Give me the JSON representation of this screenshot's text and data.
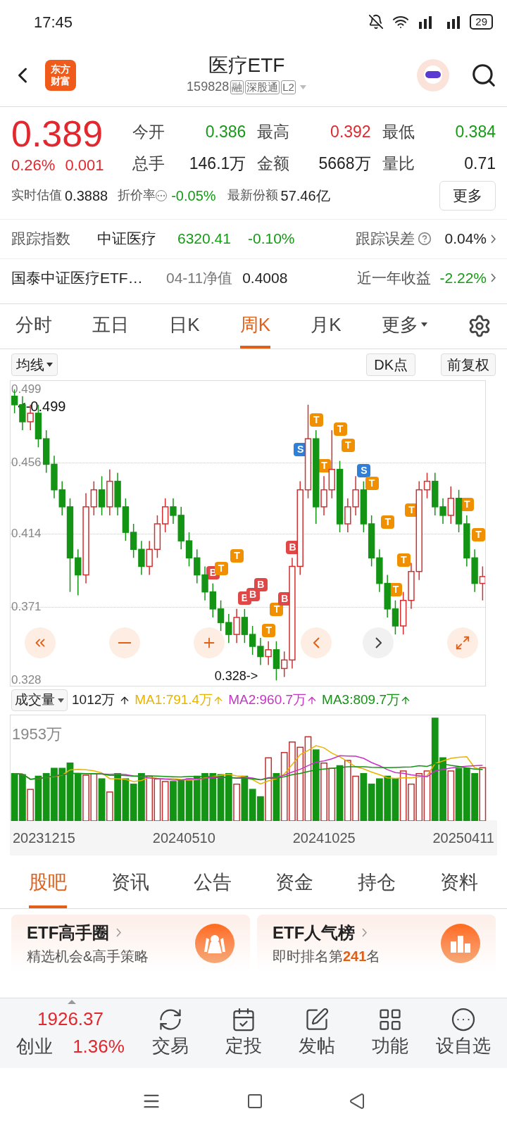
{
  "status_bar": {
    "time": "17:45",
    "battery": "29"
  },
  "header": {
    "logo_lines": [
      "东方",
      "财富"
    ],
    "title": "医疗ETF",
    "code": "159828",
    "tags": [
      "融",
      "深股通",
      "L2"
    ]
  },
  "quote": {
    "price": "0.389",
    "change_pct": "0.26%",
    "change": "0.001",
    "stats": [
      {
        "label": "今开",
        "value": "0.386",
        "color": "#169a16"
      },
      {
        "label": "最高",
        "value": "0.392",
        "color": "#e0282e"
      },
      {
        "label": "最低",
        "value": "0.384",
        "color": "#169a16"
      },
      {
        "label": "总手",
        "value": "146.1万",
        "color": "#222222"
      },
      {
        "label": "金额",
        "value": "5668万",
        "color": "#222222"
      },
      {
        "label": "量比",
        "value": "0.71",
        "color": "#222222"
      }
    ],
    "estimate_label": "实时估值",
    "estimate": "0.3888",
    "discount_label": "折价率",
    "discount": "-0.05%",
    "shares_label": "最新份额",
    "shares": "57.46亿",
    "more": "更多"
  },
  "tracking": {
    "label": "跟踪指数",
    "index": "中证医疗",
    "value": "6320.41",
    "pct": "-0.10%",
    "error_label": "跟踪误差",
    "error": "0.04%"
  },
  "fund": {
    "name": "国泰中证医疗ETF…",
    "nav_label": "04-11净值",
    "nav": "0.4008",
    "return_label": "近一年收益",
    "return": "-2.22%"
  },
  "period_tabs": [
    {
      "label": "分时",
      "selected": false
    },
    {
      "label": "五日",
      "selected": false
    },
    {
      "label": "日K",
      "selected": false
    },
    {
      "label": "周K",
      "selected": true
    },
    {
      "label": "月K",
      "selected": false
    },
    {
      "label": "更多",
      "selected": false
    }
  ],
  "chart_toolbar": {
    "ma": "均线",
    "dk": "DK点",
    "adjust": "前复权"
  },
  "kline": {
    "high_label": "<-0.499",
    "low_label": "0.328->",
    "chart_data": {
      "type": "candlestick",
      "grid": true,
      "ylim": [
        0.324,
        0.504
      ],
      "yticks": [
        0.499,
        0.456,
        0.414,
        0.371,
        0.328
      ],
      "categories": [
        null,
        null,
        null,
        null,
        null,
        null,
        null,
        null,
        null,
        null,
        null,
        null,
        null,
        null,
        null,
        null,
        null,
        null,
        null,
        null,
        null,
        null,
        null,
        null,
        null,
        null,
        null,
        null,
        null,
        null,
        null,
        null,
        null,
        null,
        null,
        null,
        null,
        null,
        null,
        null,
        null,
        null,
        null,
        null,
        null,
        null,
        null,
        null,
        null,
        null,
        null,
        null,
        null,
        null,
        null,
        null,
        null,
        null,
        null,
        null
      ],
      "ohlc": [
        [
          0.495,
          0.499,
          0.485,
          0.49
        ],
        [
          0.49,
          0.495,
          0.475,
          0.48
        ],
        [
          0.48,
          0.49,
          0.475,
          0.485
        ],
        [
          0.485,
          0.49,
          0.465,
          0.47
        ],
        [
          0.47,
          0.475,
          0.45,
          0.455
        ],
        [
          0.455,
          0.46,
          0.435,
          0.44
        ],
        [
          0.44,
          0.445,
          0.425,
          0.43
        ],
        [
          0.43,
          0.435,
          0.38,
          0.4
        ],
        [
          0.4,
          0.405,
          0.378,
          0.39
        ],
        [
          0.39,
          0.438,
          0.385,
          0.43
        ],
        [
          0.43,
          0.445,
          0.425,
          0.44
        ],
        [
          0.44,
          0.448,
          0.425,
          0.43
        ],
        [
          0.43,
          0.452,
          0.425,
          0.445
        ],
        [
          0.445,
          0.45,
          0.425,
          0.43
        ],
        [
          0.43,
          0.435,
          0.41,
          0.415
        ],
        [
          0.415,
          0.42,
          0.4,
          0.405
        ],
        [
          0.405,
          0.41,
          0.39,
          0.395
        ],
        [
          0.395,
          0.41,
          0.39,
          0.405
        ],
        [
          0.405,
          0.425,
          0.4,
          0.42
        ],
        [
          0.42,
          0.435,
          0.415,
          0.43
        ],
        [
          0.43,
          0.435,
          0.42,
          0.425
        ],
        [
          0.425,
          0.43,
          0.405,
          0.41
        ],
        [
          0.41,
          0.415,
          0.395,
          0.4
        ],
        [
          0.4,
          0.405,
          0.385,
          0.39
        ],
        [
          0.39,
          0.395,
          0.375,
          0.38
        ],
        [
          0.38,
          0.385,
          0.365,
          0.37
        ],
        [
          0.37,
          0.375,
          0.357,
          0.362
        ],
        [
          0.362,
          0.367,
          0.35,
          0.355
        ],
        [
          0.355,
          0.37,
          0.35,
          0.365
        ],
        [
          0.365,
          0.37,
          0.35,
          0.355
        ],
        [
          0.355,
          0.36,
          0.343,
          0.348
        ],
        [
          0.348,
          0.353,
          0.337,
          0.342
        ],
        [
          0.342,
          0.351,
          0.337,
          0.346
        ],
        [
          0.346,
          0.351,
          0.328,
          0.335
        ],
        [
          0.335,
          0.345,
          0.33,
          0.34
        ],
        [
          0.34,
          0.4,
          0.335,
          0.395
        ],
        [
          0.395,
          0.445,
          0.39,
          0.44
        ],
        [
          0.44,
          0.49,
          0.435,
          0.47
        ],
        [
          0.47,
          0.475,
          0.42,
          0.43
        ],
        [
          0.43,
          0.448,
          0.425,
          0.44
        ],
        [
          0.44,
          0.475,
          0.435,
          0.452
        ],
        [
          0.452,
          0.457,
          0.415,
          0.42
        ],
        [
          0.42,
          0.435,
          0.415,
          0.43
        ],
        [
          0.43,
          0.448,
          0.425,
          0.44
        ],
        [
          0.44,
          0.445,
          0.415,
          0.42
        ],
        [
          0.42,
          0.425,
          0.395,
          0.4
        ],
        [
          0.4,
          0.405,
          0.38,
          0.385
        ],
        [
          0.385,
          0.39,
          0.365,
          0.37
        ],
        [
          0.37,
          0.375,
          0.355,
          0.36
        ],
        [
          0.36,
          0.38,
          0.355,
          0.375
        ],
        [
          0.375,
          0.397,
          0.37,
          0.392
        ],
        [
          0.392,
          0.445,
          0.387,
          0.44
        ],
        [
          0.44,
          0.45,
          0.435,
          0.445
        ],
        [
          0.445,
          0.45,
          0.425,
          0.43
        ],
        [
          0.43,
          0.435,
          0.42,
          0.425
        ],
        [
          0.425,
          0.442,
          0.42,
          0.435
        ],
        [
          0.435,
          0.44,
          0.415,
          0.42
        ],
        [
          0.42,
          0.425,
          0.395,
          0.4
        ],
        [
          0.4,
          0.405,
          0.38,
          0.385
        ],
        [
          0.385,
          0.395,
          0.375,
          0.389
        ]
      ]
    },
    "dk_marks": [
      {
        "label": "B",
        "kind": "buy"
      },
      {
        "label": "T",
        "kind": "t"
      },
      {
        "label": "T",
        "kind": "t"
      },
      {
        "label": "B",
        "kind": "buy"
      },
      {
        "label": "B",
        "kind": "buy"
      },
      {
        "label": "B",
        "kind": "buy"
      },
      {
        "label": "T",
        "kind": "t"
      },
      {
        "label": "T",
        "kind": "t"
      },
      {
        "label": "B",
        "kind": "buy"
      },
      {
        "label": "B",
        "kind": "buy"
      },
      {
        "label": "S",
        "kind": "sell"
      },
      {
        "label": "T",
        "kind": "t"
      },
      {
        "label": "T",
        "kind": "t"
      },
      {
        "label": "T",
        "kind": "t"
      },
      {
        "label": "T",
        "kind": "t"
      },
      {
        "label": "S",
        "kind": "sell"
      },
      {
        "label": "T",
        "kind": "t"
      },
      {
        "label": "T",
        "kind": "t"
      },
      {
        "label": "T",
        "kind": "t"
      },
      {
        "label": "T",
        "kind": "t"
      },
      {
        "label": "T",
        "kind": "t"
      },
      {
        "label": "T",
        "kind": "t"
      },
      {
        "label": "T",
        "kind": "t"
      }
    ]
  },
  "volume": {
    "label": "成交量",
    "value": "1012万",
    "max_label": "1953万",
    "mas": [
      {
        "label": "MA1:791.4万",
        "color": "#e8b400"
      },
      {
        "label": "MA2:960.7万",
        "color": "#c535c5"
      },
      {
        "label": "MA3:809.7万",
        "color": "#139413"
      }
    ],
    "dates": [
      "20231215",
      "20240510",
      "20241025",
      "20250411"
    ]
  },
  "section_tabs": [
    {
      "label": "股吧",
      "selected": true
    },
    {
      "label": "资讯",
      "selected": false
    },
    {
      "label": "公告",
      "selected": false
    },
    {
      "label": "资金",
      "selected": false
    },
    {
      "label": "持仓",
      "selected": false
    },
    {
      "label": "资料",
      "selected": false
    }
  ],
  "cards": [
    {
      "title": "ETF高手圈",
      "subtitle": [
        "精选机会&高手策略"
      ],
      "kind": "circle"
    },
    {
      "title": "ETF人气榜",
      "subtitle": [
        "即时排名第",
        "241",
        "名"
      ],
      "kind": "rank"
    }
  ],
  "bottom_nav": {
    "index_value": "1926.37",
    "index_name": "创业",
    "index_pct": "1.36%",
    "items": [
      {
        "label": "交易",
        "kind": "trade"
      },
      {
        "label": "定投",
        "kind": "plan"
      },
      {
        "label": "发帖",
        "kind": "post"
      },
      {
        "label": "功能",
        "kind": "apps"
      },
      {
        "label": "设自选",
        "kind": "more"
      }
    ]
  }
}
